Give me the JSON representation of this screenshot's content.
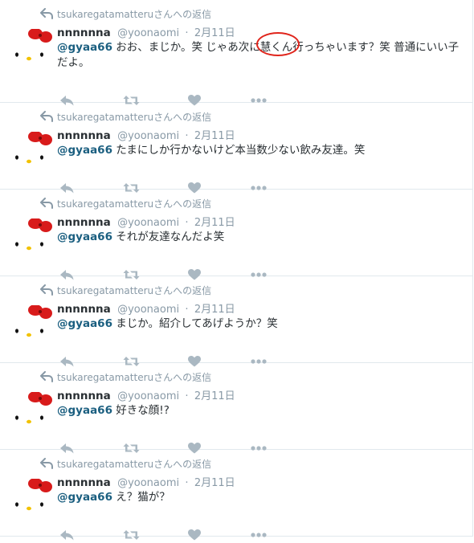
{
  "context_label": "tsukaregatamatteruさんへの返信",
  "author": {
    "name": "nnnnnna",
    "handle": "@yoonaomi"
  },
  "dot": "·",
  "tweets": [
    {
      "time": "2月11日",
      "mention": "@gyaa66",
      "text": "おお、まじか。笑 じゃあ次に慧くん行っちゃいます？笑 普通にいい子だよ。"
    },
    {
      "time": "2月11日",
      "mention": "@gyaa66",
      "text": "たまにしか行かないけど本当数少ない飲み友達。笑"
    },
    {
      "time": "2月11日",
      "mention": "@gyaa66",
      "text": "それが友達なんだよ笑"
    },
    {
      "time": "2月11日",
      "mention": "@gyaa66",
      "text": "まじか。紹介してあげようか？笑"
    },
    {
      "time": "2月11日",
      "mention": "@gyaa66",
      "text": "好きな顔!?"
    },
    {
      "time": "2月11日",
      "mention": "@gyaa66",
      "text": "え？猫が？"
    }
  ],
  "icons": {
    "reply": "reply-icon",
    "retweet": "retweet-icon",
    "like": "heart-icon",
    "more": "more-icon",
    "avatar": "hello-kitty-avatar"
  },
  "colors": {
    "mention": "#1b5f80",
    "action_icon": "#aab8c2",
    "meta_text": "#8899a6",
    "circle_annotation": "#e0241b"
  }
}
